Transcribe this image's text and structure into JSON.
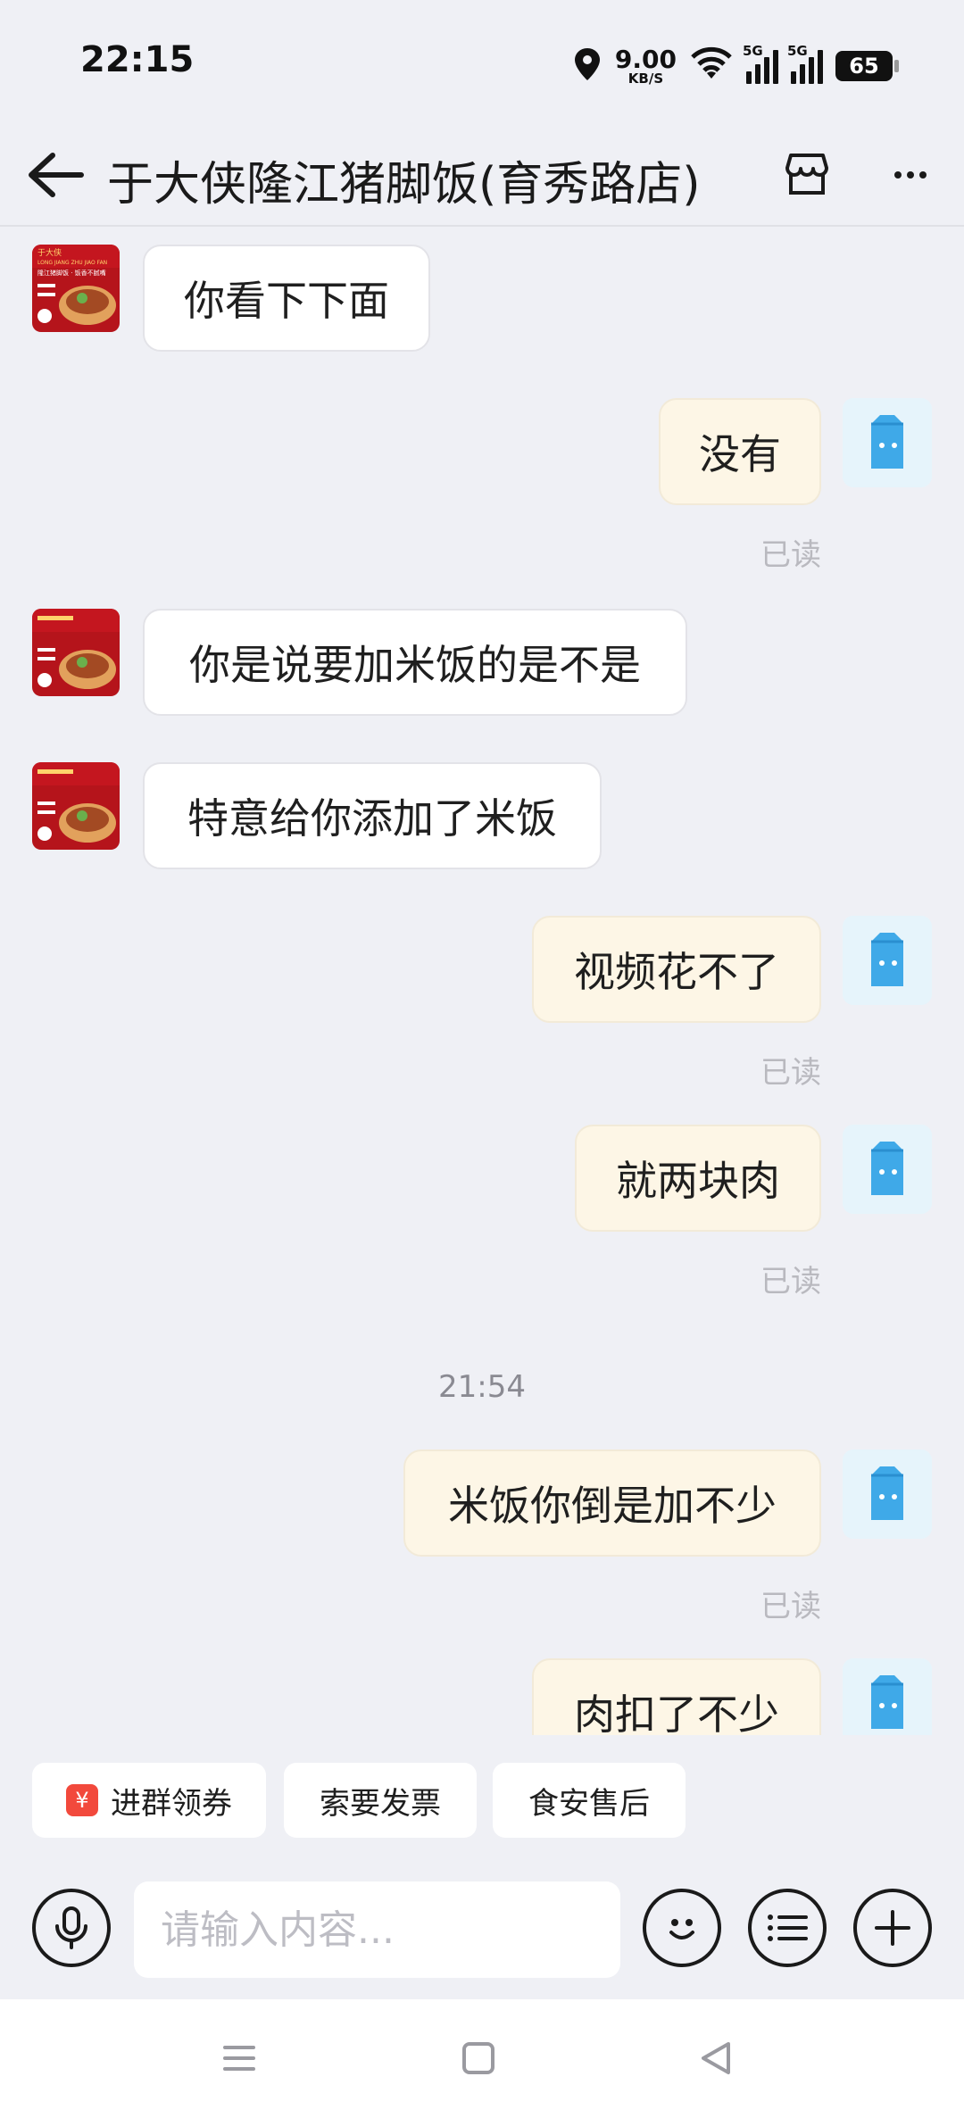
{
  "status_bar": {
    "time": "22:15",
    "net_speed_value": "9.00",
    "net_speed_unit": "KB/S",
    "sim1": "5G",
    "sim2": "5G",
    "battery": "65"
  },
  "header": {
    "title": "于大侠隆江猪脚饭(育秀路店)"
  },
  "messages": [
    {
      "side": "in",
      "text": "你看下下面"
    },
    {
      "side": "out",
      "text": "没有",
      "status": "已读"
    },
    {
      "side": "in",
      "text": "你是说要加米饭的是不是"
    },
    {
      "side": "in",
      "text": "特意给你添加了米饭"
    },
    {
      "side": "out",
      "text": "视频花不了",
      "status": "已读"
    },
    {
      "side": "out",
      "text": "就两块肉",
      "status": "已读"
    },
    {
      "side": "time",
      "text": "21:54"
    },
    {
      "side": "out",
      "text": "米饭你倒是加不少",
      "status": "已读"
    },
    {
      "side": "out",
      "text": "肉扣了不少"
    }
  ],
  "quick_actions": [
    {
      "label": "进群领券",
      "icon": "coupon-icon"
    },
    {
      "label": "索要发票"
    },
    {
      "label": "食安售后"
    }
  ],
  "input": {
    "placeholder": "请输入内容..."
  },
  "shop_avatar_text": {
    "brand": "于大侠",
    "english": "LONG JIANG ZHU JIAO FAN",
    "slogan": "隆江猪脚饭 · 饭香不腻嘴"
  },
  "colors": {
    "background": "#eff0f5",
    "bubble_in": "#ffffff",
    "bubble_out": "#fdf6e6",
    "read_status": "#b9b9bf",
    "avatar_me_bg": "#e6f4fb",
    "avatar_me_icon": "#3fa9e8",
    "coupon_red": "#f2493c"
  }
}
